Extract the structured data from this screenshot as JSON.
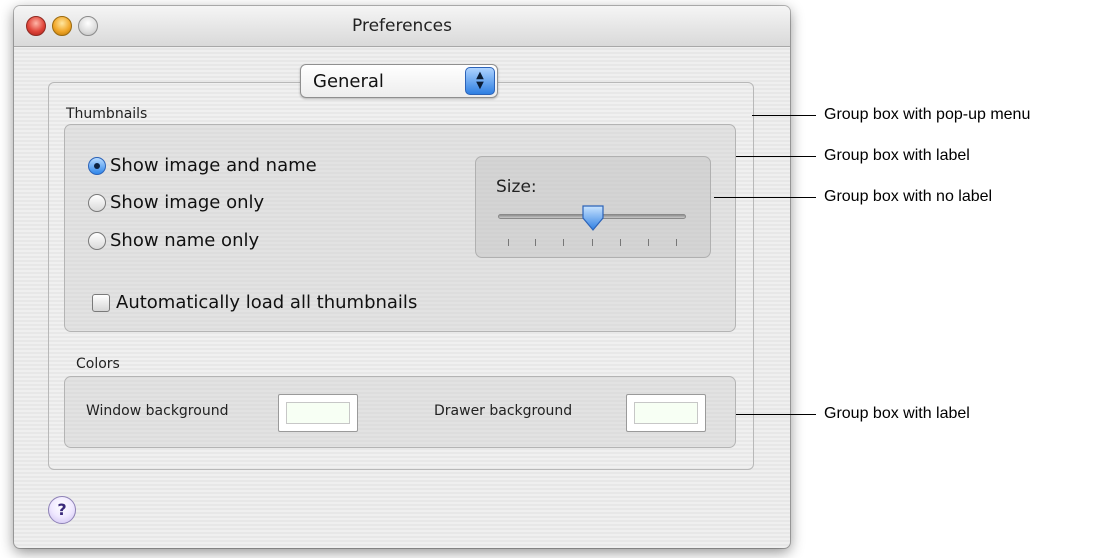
{
  "window": {
    "title": "Preferences"
  },
  "popup_menu": {
    "selected": "General"
  },
  "thumbnails": {
    "label": "Thumbnails",
    "options": [
      {
        "label": "Show image and name",
        "selected": true
      },
      {
        "label": "Show image only",
        "selected": false
      },
      {
        "label": "Show name only",
        "selected": false
      }
    ],
    "auto_load_label": "Automatically load all thumbnails",
    "auto_load_checked": false,
    "size_label": "Size:",
    "size_ticks": 7,
    "size_value_index": 3
  },
  "colors": {
    "label": "Colors",
    "window_bg_label": "Window background",
    "drawer_bg_label": "Drawer background",
    "window_bg_color": "#f7fff4",
    "drawer_bg_color": "#f7fff4"
  },
  "help": {
    "symbol": "?"
  },
  "callouts": [
    "Group box with pop-up menu",
    "Group box with label",
    "Group box with no label",
    "Group box with label"
  ],
  "theme": {
    "window_bg": "#ececec",
    "accent": "#2f86ea",
    "close": "#e0453a",
    "minimize": "#f1a72a",
    "zoom": "#cfcfcf"
  }
}
